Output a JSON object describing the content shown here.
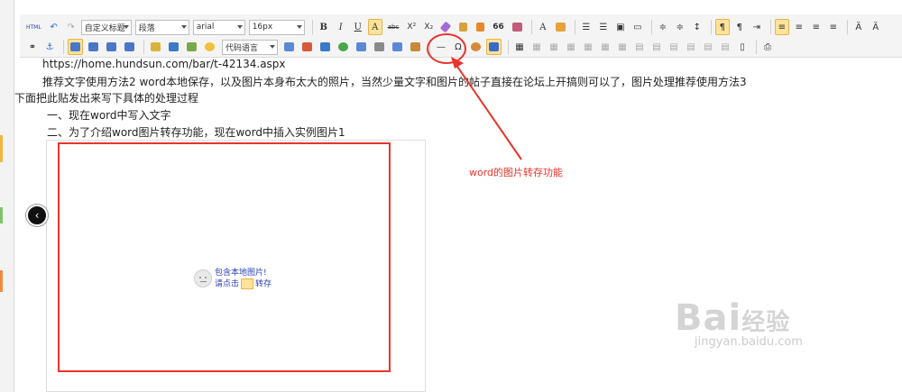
{
  "toolbar": {
    "row1": {
      "source_label": "HTML",
      "undo_icon": "undo-icon",
      "redo_icon": "redo-icon",
      "custom_title": "自定义标题",
      "paragraph": "段落",
      "font_family": "arial",
      "font_size": "16px",
      "bold": "B",
      "italic": "I",
      "underline": "U",
      "font_border": "A",
      "strikethrough": "abc",
      "superscript": "X²",
      "subscript": "X₂",
      "quote": "66",
      "font_color": "A",
      "direction_ltr": "¶",
      "direction_rtl": "¶",
      "format_symbol": "Ä",
      "format_symbol_2": "Ä"
    },
    "row2": {
      "code_language": "代码语言",
      "omega": "Ω",
      "horizontal_line": "—"
    }
  },
  "content": {
    "url_line": "https://home.hundsun.com/bar/t-42134.aspx",
    "para1": "推荐文字使用方法2 word本地保存，以及图片本身布太大的照片，当然少量文字和图片的帖子直接在论坛上开搞则可以了，图片处理推荐使用方法3",
    "para2": "下面把此贴发出来写下具体的处理过程",
    "step1": "一、现在word中写入文字",
    "step2": "二、为了介绍word图片转存功能，现在word中插入实例图片1"
  },
  "annotation": {
    "label": "word的图片转存功能",
    "color": "#e8342c"
  },
  "image_placeholder": {
    "line1": "包含本地图片!",
    "line2_prefix": "请点击",
    "line2_suffix": "转存"
  },
  "watermark": {
    "main": "Bai",
    "brand": "经验",
    "sub": "jingyan.baidu.com"
  },
  "colors": {
    "active_button": "#ffe39a",
    "active_border": "#e6b34a",
    "link_blue": "#2a3fb8"
  }
}
